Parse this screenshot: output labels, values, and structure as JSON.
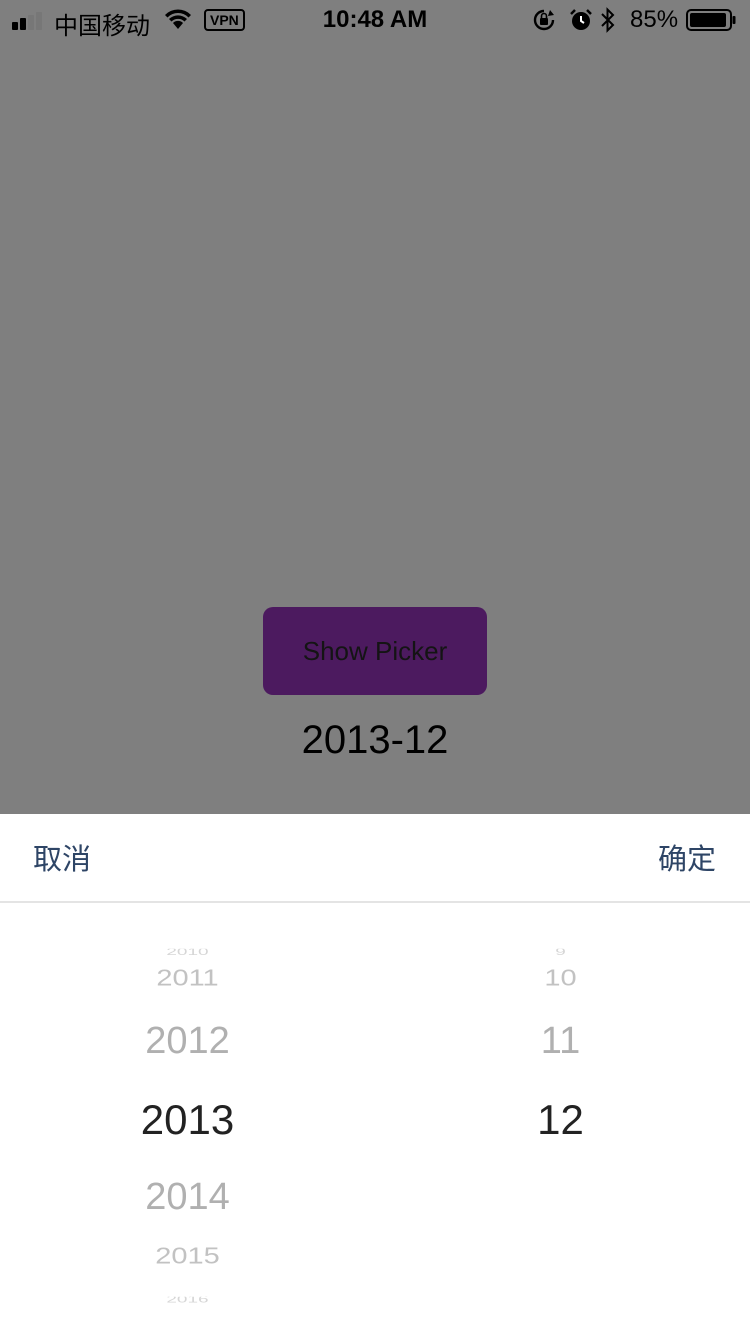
{
  "status_bar": {
    "carrier": "中国移动",
    "vpn": "VPN",
    "time": "10:48 AM",
    "battery": "85%"
  },
  "main": {
    "show_picker_label": "Show Picker",
    "selected_value": "2013-12"
  },
  "picker": {
    "cancel_label": "取消",
    "confirm_label": "确定",
    "year_column": [
      "2010",
      "2011",
      "2012",
      "2013",
      "2014",
      "2015",
      "2016"
    ],
    "month_column": [
      "9",
      "10",
      "11",
      "12"
    ],
    "selected_year": "2013",
    "selected_month": "12"
  },
  "colors": {
    "backdrop": "#7f7f7f",
    "button": "#4c1a5f",
    "toolbar_text": "#2e4566"
  }
}
